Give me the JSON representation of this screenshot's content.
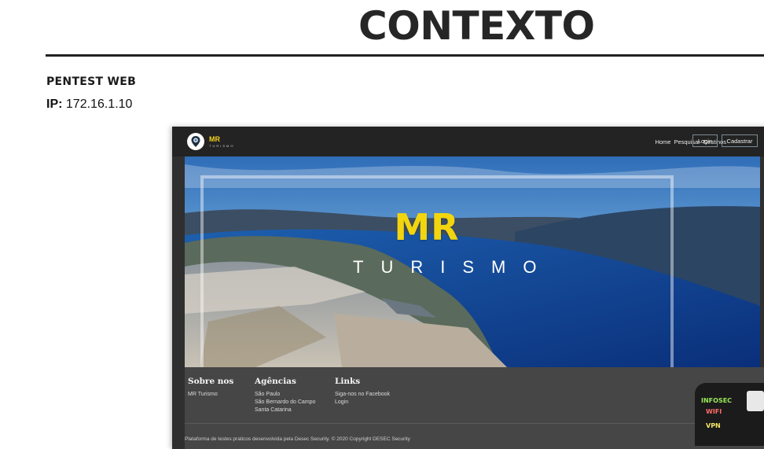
{
  "slide": {
    "title": "CONTEXTO",
    "subtitle": "PENTEST WEB",
    "ip_label": "IP:",
    "ip_value": "172.16.1.10"
  },
  "site": {
    "logo_title": "MR",
    "logo_sub": "TURISMO",
    "nav": [
      "Home",
      "Pesquisar",
      "Destinos"
    ],
    "login_button": "Login",
    "signup_button": "Cadastrar",
    "hero_title": "MR",
    "hero_subtitle": "TURISMO",
    "footer": {
      "sobre_title": "Sobre nos",
      "sobre_links": [
        "MR Turismo"
      ],
      "agencias_title": "Agências",
      "agencias_links": [
        "São Paulo",
        "São Bernardo do Campo",
        "Santa Catarina"
      ],
      "links_title": "Links",
      "links_links": [
        "Siga-nos no Facebook",
        "Login"
      ],
      "copyright": "Plataforma de testes praticos desenvolvida pela Desec Security.     © 2020 Copyright DESEC Security"
    }
  },
  "webcam_overlay": {
    "labels": [
      "INFOSEC",
      "WIFI",
      "VPN"
    ]
  },
  "colors": {
    "accent_yellow": "#f2d50f",
    "header_bg": "#232323",
    "footer_bg": "#464646"
  }
}
